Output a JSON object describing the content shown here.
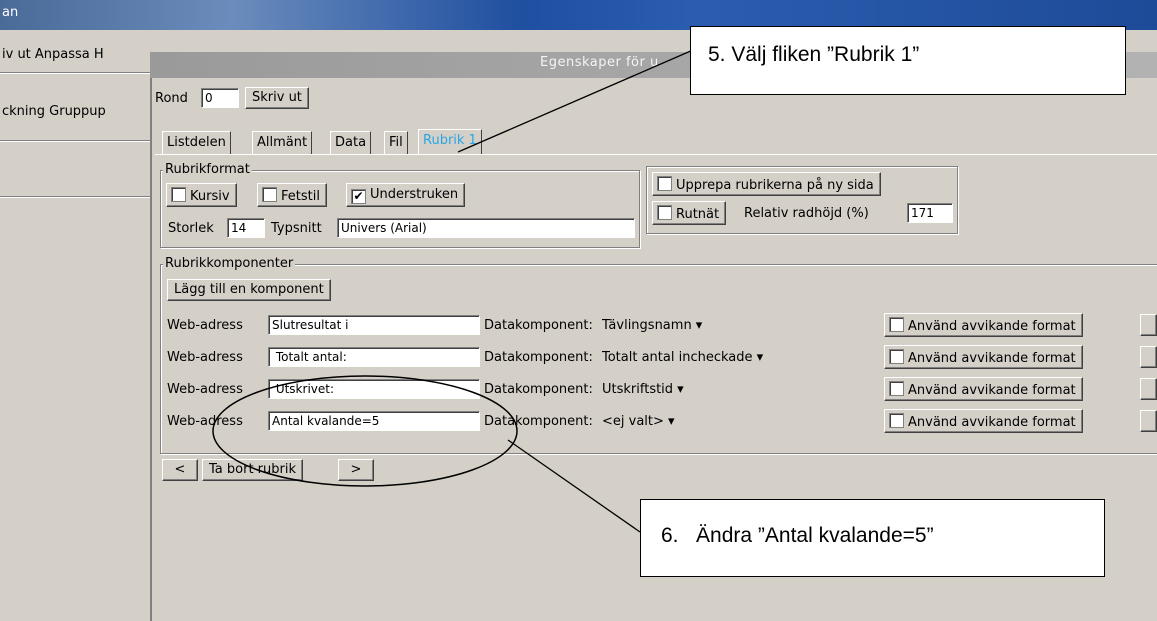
{
  "main_window": {
    "title": "an"
  },
  "left_pane": {
    "menu_text": "iv ut Anpassa H",
    "tabs_text": "ckning Gruppup"
  },
  "dialog": {
    "title": "Egenskaper för u",
    "round_label": "Rond",
    "round_value": "0",
    "print_button": "Skriv ut",
    "tabs": [
      "Listdelen",
      "Allmänt",
      "Data",
      "Fil",
      "Rubrik 1"
    ],
    "rubrikformat": {
      "legend": "Rubrikformat",
      "kursiv": "Kursiv",
      "fetstil": "Fetstil",
      "understruken": "Understruken",
      "understruken_checked": "✔",
      "storlek_label": "Storlek",
      "storlek_value": "14",
      "typsnitt_label": "Typsnitt",
      "typsnitt_value": "Univers (Arial)"
    },
    "upprepa": "Upprepa rubrikerna på ny sida",
    "rutnat": "Rutnät",
    "relativ_label": "Relativ radhöjd (%)",
    "relativ_value": "171",
    "komponenter": {
      "legend": "Rubrikkomponenter",
      "add_button": "Lägg till en komponent",
      "rows": [
        {
          "label": "Web-adress",
          "value": "Slutresultat i",
          "dk_label": "Datakomponent:",
          "dk_value": "Tävlingsnamn ▾",
          "format": "Använd avvikande format"
        },
        {
          "label": "Web-adress",
          "value": " Totalt antal:",
          "dk_label": "Datakomponent:",
          "dk_value": "Totalt antal incheckade ▾",
          "format": "Använd avvikande format"
        },
        {
          "label": "Web-adress",
          "value": " Utskrivet:",
          "dk_label": "Datakomponent:",
          "dk_value": "Utskriftstid ▾",
          "format": "Använd avvikande format"
        },
        {
          "label": "Web-adress",
          "value": "Antal kvalande=5",
          "dk_label": "Datakomponent:",
          "dk_value": "<ej valt> ▾",
          "format": "Använd avvikande format"
        }
      ]
    },
    "nav": {
      "prev": "<",
      "remove": "Ta bort rubrik",
      "next": ">"
    }
  },
  "callouts": {
    "step5": "5. Välj fliken ”Rubrik 1”",
    "step6": "6.   Ändra ”Antal kvalande=5”"
  }
}
